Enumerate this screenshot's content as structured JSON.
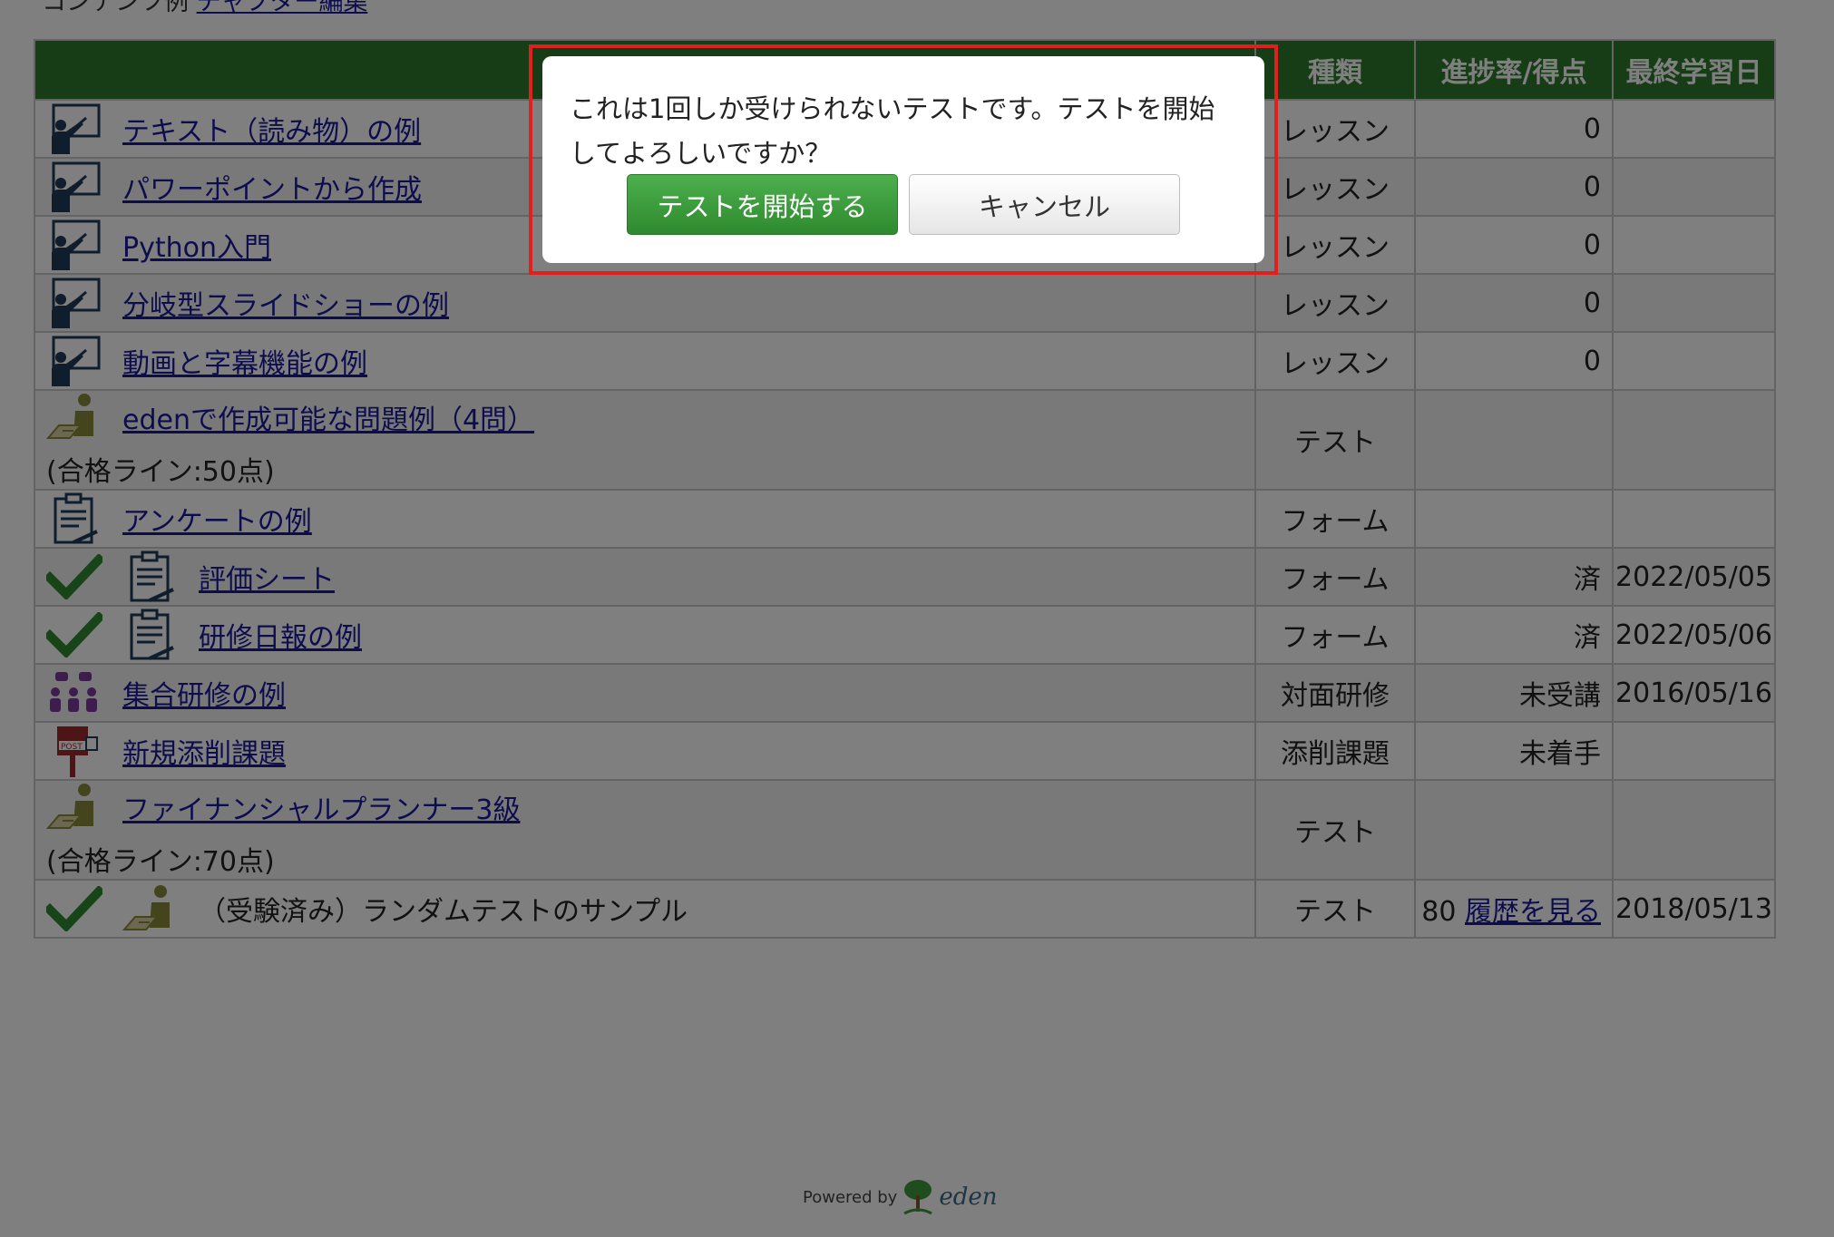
{
  "breadcrumb": {
    "prefix": "コンテンツ例",
    "link": "チャプター編集"
  },
  "table": {
    "headers": {
      "name": "",
      "kind": "種類",
      "progress": "進捗率/得点",
      "date": "最終学習日"
    },
    "rows": [
      {
        "icon": "lesson-icon",
        "title": "テキスト（読み物）の例",
        "link": true,
        "kind": "レッスン",
        "progress": "0",
        "date": "",
        "pass": ""
      },
      {
        "icon": "lesson-icon",
        "title": "パワーポイントから作成",
        "link": true,
        "kind": "レッスン",
        "progress": "0",
        "date": "",
        "pass": ""
      },
      {
        "icon": "lesson-icon",
        "title": "Python入門",
        "link": true,
        "kind": "レッスン",
        "progress": "0",
        "date": "",
        "pass": ""
      },
      {
        "icon": "lesson-icon",
        "title": "分岐型スライドショーの例",
        "link": true,
        "kind": "レッスン",
        "progress": "0",
        "date": "",
        "pass": ""
      },
      {
        "icon": "lesson-icon",
        "title": "動画と字幕機能の例",
        "link": true,
        "kind": "レッスン",
        "progress": "0",
        "date": "",
        "pass": ""
      },
      {
        "icon": "test-icon",
        "title": "edenで作成可能な問題例（4問）",
        "link": true,
        "kind": "テスト",
        "progress": "",
        "date": "",
        "pass": "(合格ライン:50点)"
      },
      {
        "icon": "form-icon",
        "title": "アンケートの例",
        "link": true,
        "kind": "フォーム",
        "progress": "",
        "date": "",
        "pass": ""
      },
      {
        "icon": "form-icon",
        "done": true,
        "title": "評価シート",
        "link": true,
        "kind": "フォーム",
        "progress": "済",
        "date": "2022/05/05",
        "pass": ""
      },
      {
        "icon": "form-icon",
        "done": true,
        "title": "研修日報の例",
        "link": true,
        "kind": "フォーム",
        "progress": "済",
        "date": "2022/05/06",
        "pass": ""
      },
      {
        "icon": "group-training-icon",
        "title": "集合研修の例",
        "link": true,
        "kind": "対面研修",
        "progress": "未受講",
        "date": "2016/05/16",
        "pass": ""
      },
      {
        "icon": "post-icon",
        "title": "新規添削課題",
        "link": true,
        "kind": "添削課題",
        "progress": "未着手",
        "date": "",
        "pass": ""
      },
      {
        "icon": "test-icon",
        "title": "ファイナンシャルプランナー3級",
        "link": true,
        "kind": "テスト",
        "progress": "",
        "date": "",
        "pass": "(合格ライン:70点)"
      },
      {
        "icon": "test-icon",
        "done": true,
        "title": "（受験済み）ランダムテストのサンプル",
        "link": false,
        "kind": "テスト",
        "progress": "80",
        "progress_link": "履歴を見る",
        "date": "2018/05/13",
        "pass": ""
      }
    ]
  },
  "footer": {
    "powered_by": "Powered by",
    "brand": "eden"
  },
  "dialog": {
    "message": "これは1回しか受けられないテストです。テストを開始してよろしいですか？",
    "start_label": "テストを開始する",
    "cancel_label": "キャンセル"
  },
  "colors": {
    "header_green": "#2f7a2f",
    "highlight_red": "#e01f1f",
    "check_green": "#2e8b2e"
  }
}
